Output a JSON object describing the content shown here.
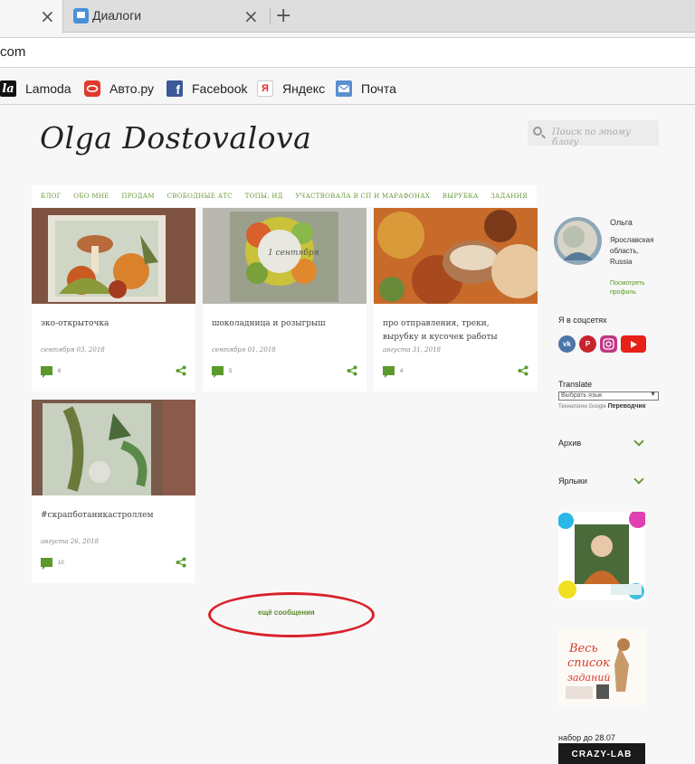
{
  "browser": {
    "tabs": [
      {
        "title": ""
      },
      {
        "title": "Диалоги"
      }
    ],
    "new_tab": "+",
    "close_glyph": "×",
    "url": "com",
    "bookmarks": [
      {
        "label": "Lamoda",
        "icon": "lamoda-icon",
        "glyph": "la"
      },
      {
        "label": "Авто.ру",
        "icon": "autoru-icon",
        "glyph": ""
      },
      {
        "label": "Facebook",
        "icon": "facebook-icon",
        "glyph": "f"
      },
      {
        "label": "Яндекс",
        "icon": "yandex-icon",
        "glyph": "Я"
      },
      {
        "label": "Почта",
        "icon": "mail-icon",
        "glyph": ""
      }
    ]
  },
  "blog": {
    "title": "Olga Dostovalova",
    "search_placeholder": "Поиск по этому блогу",
    "nav": [
      "БЛОГ",
      "ОБО МНЕ",
      "ПРОДАМ",
      "СВОБОДНЫЕ АТС",
      "ТОПЫ, ИД",
      "УЧАСТВОВАЛА В СП И МАРАФОНАХ",
      "ВЫРУБКА",
      "ЗАДАНИЯ"
    ],
    "posts": [
      {
        "title": "эко-открыточка",
        "date": "сентября 03, 2018",
        "comments": "6"
      },
      {
        "title": "шоколадница и розыгрыш",
        "date": "сентября 01, 2018",
        "comments": "5"
      },
      {
        "title": "про отправления, треки, вырубку и кусочек работы",
        "date": "августа 31, 2018",
        "comments": "4"
      },
      {
        "title": "#скрапботаникастроллем",
        "date": "августа 26, 2018",
        "comments": "10"
      }
    ],
    "more_posts": "ещё сообщения"
  },
  "sidebar": {
    "profile": {
      "name": "Ольга",
      "location": "Ярославская область, Russia",
      "view_profile": "Посмотреть профиль"
    },
    "social_heading": "Я в соцсетях",
    "social": [
      "vk-icon",
      "pinterest-icon",
      "instagram-icon",
      "youtube-icon"
    ],
    "translate_heading": "Translate",
    "translate_select": "Выбрать язык",
    "translate_powered": "Технологии",
    "translate_google": "Google",
    "translate_service": "Переводчик",
    "archive": "Архив",
    "labels": "Ярлыки",
    "note": "набор до 28.07",
    "banner_text": "CRAZY-LAB"
  },
  "colors": {
    "accent": "#5a9a2c",
    "annotation": "#d9222a"
  }
}
